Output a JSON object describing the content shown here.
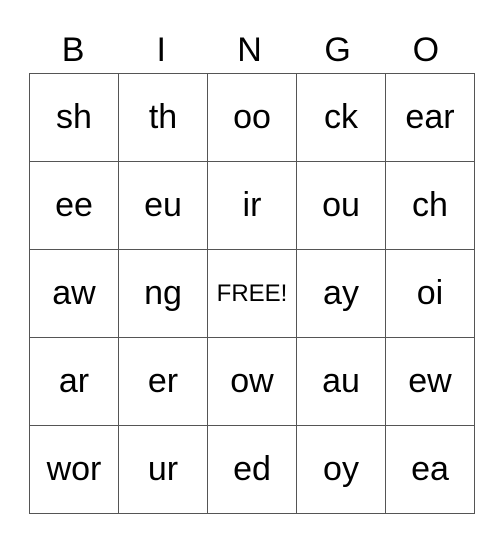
{
  "header": [
    "B",
    "I",
    "N",
    "G",
    "O"
  ],
  "rows": [
    [
      "sh",
      "th",
      "oo",
      "ck",
      "ear"
    ],
    [
      "ee",
      "eu",
      "ir",
      "ou",
      "ch"
    ],
    [
      "aw",
      "ng",
      "FREE!",
      "ay",
      "oi"
    ],
    [
      "ar",
      "er",
      "ow",
      "au",
      "ew"
    ],
    [
      "wor",
      "ur",
      "ed",
      "oy",
      "ea"
    ]
  ],
  "free_position": [
    2,
    2
  ]
}
